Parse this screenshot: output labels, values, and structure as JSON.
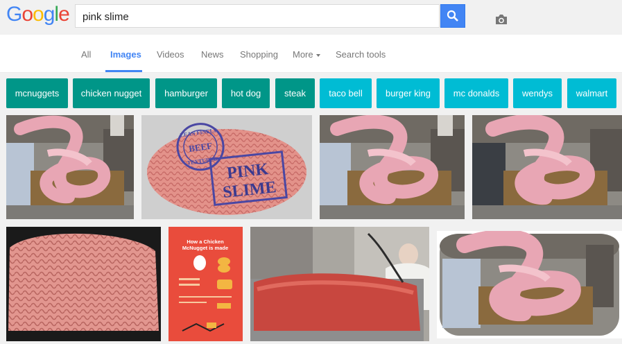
{
  "logo": {
    "letters": [
      "G",
      "o",
      "o",
      "g",
      "l",
      "e"
    ],
    "colors": [
      "#4285f4",
      "#ea4335",
      "#fbbc05",
      "#4285f4",
      "#34a853",
      "#ea4335"
    ]
  },
  "search": {
    "query": "pink slime"
  },
  "icons": {
    "camera": "camera-icon",
    "search": "search-icon",
    "caret": "caret-down-icon"
  },
  "tabs": [
    {
      "label": "All",
      "active": false
    },
    {
      "label": "Images",
      "active": true
    },
    {
      "label": "Videos",
      "active": false
    },
    {
      "label": "News",
      "active": false
    },
    {
      "label": "Shopping",
      "active": false
    },
    {
      "label": "More",
      "active": false
    },
    {
      "label": "Search tools",
      "active": false
    }
  ],
  "chips": [
    {
      "label": "mcnuggets",
      "style": "dark"
    },
    {
      "label": "chicken nugget",
      "style": "dark"
    },
    {
      "label": "hamburger",
      "style": "dark"
    },
    {
      "label": "hot dog",
      "style": "dark"
    },
    {
      "label": "steak",
      "style": "dark"
    },
    {
      "label": "taco bell",
      "style": "light"
    },
    {
      "label": "burger king",
      "style": "light"
    },
    {
      "label": "mc donalds",
      "style": "light"
    },
    {
      "label": "wendys",
      "style": "light"
    },
    {
      "label": "walmart",
      "style": "light"
    }
  ],
  "colors": {
    "accent": "#4285f4",
    "chip_dark": "#009688",
    "chip_light": "#00bcd4"
  },
  "images": {
    "stamp": {
      "top_text": "LEAN FINELY",
      "middle_text": "BEEF",
      "bottom_text": "TEXTURED",
      "big_line1": "PINK",
      "big_line2": "SLIME"
    },
    "poster": {
      "title_line1": "How a Chicken",
      "title_line2": "McNugget is made"
    }
  }
}
